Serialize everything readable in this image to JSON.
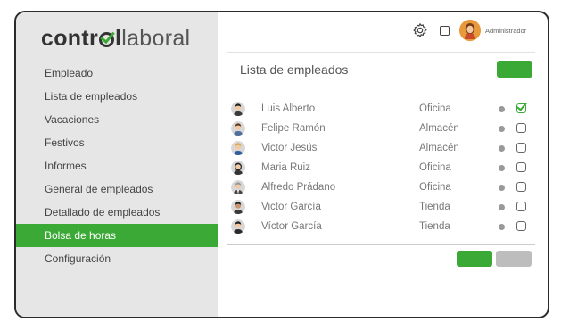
{
  "brand": {
    "part1": "contr",
    "part2": "l",
    "part3": "laboral"
  },
  "colors": {
    "accent": "#3aa935",
    "sidebar": "#e6e6e6",
    "neutral_button": "#bdbdbd"
  },
  "header": {
    "settings_icon": "gear-icon",
    "window_icon": "square-icon",
    "user_label": "Administrador"
  },
  "sidebar": {
    "items": [
      {
        "label": "Empleado"
      },
      {
        "label": "Lista de empleados"
      },
      {
        "label": "Vacaciones"
      },
      {
        "label": "Festivos"
      },
      {
        "label": "Informes"
      },
      {
        "label": "General de empleados"
      },
      {
        "label": "Detallado de empleados"
      },
      {
        "label": "Bolsa de horas",
        "active": true
      },
      {
        "label": "Configuración"
      }
    ]
  },
  "main": {
    "title": "Lista de empleados",
    "employees": [
      {
        "name": "Luis Alberto",
        "dept": "Oficina",
        "checked": true
      },
      {
        "name": "Felipe Ramón",
        "dept": "Almacén",
        "checked": false
      },
      {
        "name": "Victor Jesús",
        "dept": "Almacén",
        "checked": false
      },
      {
        "name": "Maria Ruiz",
        "dept": "Oficina",
        "checked": false
      },
      {
        "name": "Alfredo Prádano",
        "dept": "Oficina",
        "checked": false
      },
      {
        "name": "Victor García",
        "dept": "Tienda",
        "checked": false
      },
      {
        "name": "Víctor García",
        "dept": "Tienda",
        "checked": false
      }
    ]
  }
}
